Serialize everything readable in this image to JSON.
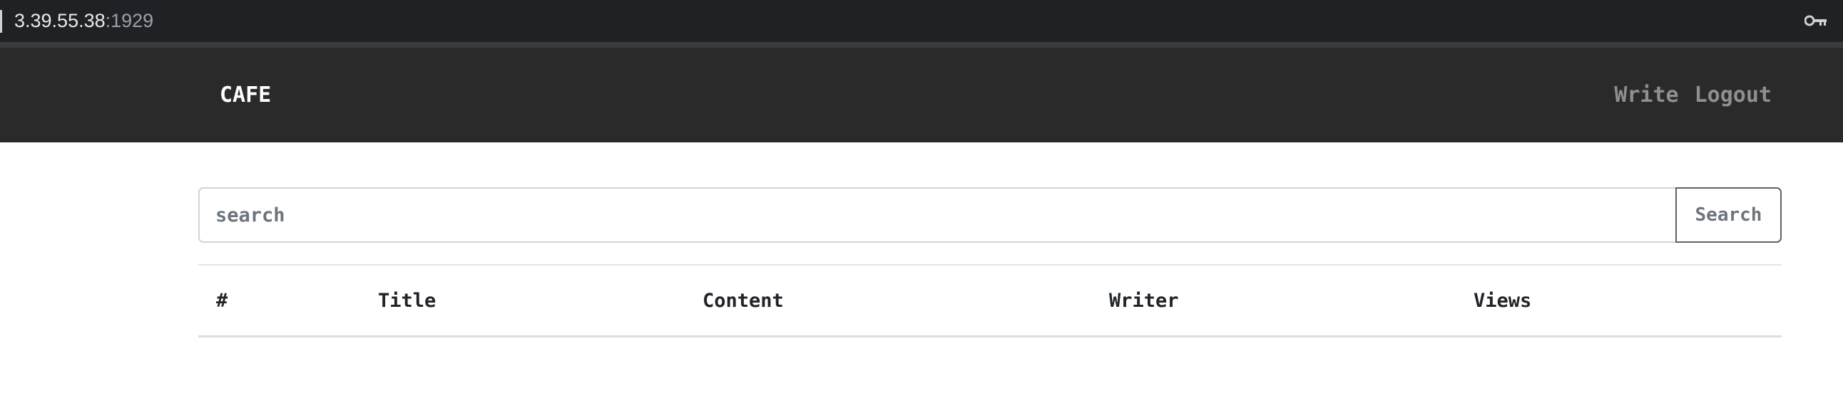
{
  "browser": {
    "url_host": "3.39.55.38",
    "url_port": ":1929",
    "key_icon": "key-icon"
  },
  "navbar": {
    "brand": "CAFE",
    "links": [
      "Write",
      "Logout"
    ]
  },
  "search": {
    "placeholder": "search",
    "value": "",
    "button_label": "Search"
  },
  "table": {
    "headers": [
      "#",
      "Title",
      "Content",
      "Writer",
      "Views"
    ],
    "rows": []
  },
  "colors": {
    "navbar_bg": "#2b2a2b",
    "address_bar_bg": "#202124",
    "nav_link": "#8f8f8f"
  }
}
